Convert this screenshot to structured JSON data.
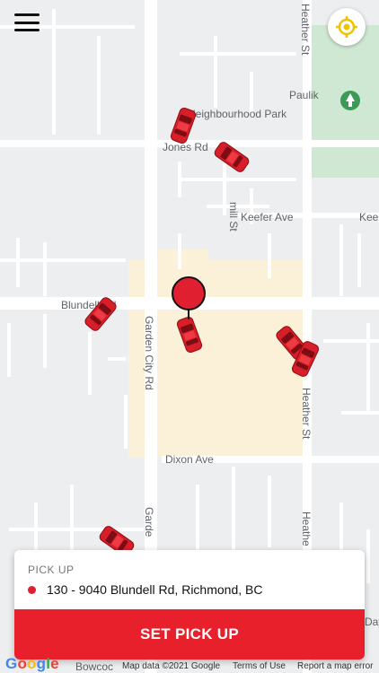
{
  "map": {
    "labels": {
      "park": "Paulik",
      "park2": "Neighbourhood Park",
      "jones": "Jones Rd",
      "mill": "mill St",
      "keefer": "Keefer Ave",
      "keefer2": "Kee",
      "blundell": "Blundell Rd",
      "garden": "Garden City Rd",
      "garden2": "Garde",
      "heather_top": "Heather St",
      "heather_mid": "Heather St",
      "heather_bot": "Heathe",
      "dixon": "Dixon Ave",
      "bowcock": "Bowcoc",
      "day": "Day"
    }
  },
  "menu": {
    "icon": "hamburger-menu-icon"
  },
  "locate": {
    "icon": "crosshair-icon",
    "color": "#f2c100"
  },
  "card": {
    "label": "PICK UP",
    "address": "130 - 9040 Blundell Rd, Richmond, BC",
    "button": "SET PICK UP",
    "accent": "#e8202c"
  },
  "footer": {
    "brand": "Google",
    "data": "Map data ©2021 Google",
    "terms": "Terms of Use",
    "report": "Report a map error"
  }
}
